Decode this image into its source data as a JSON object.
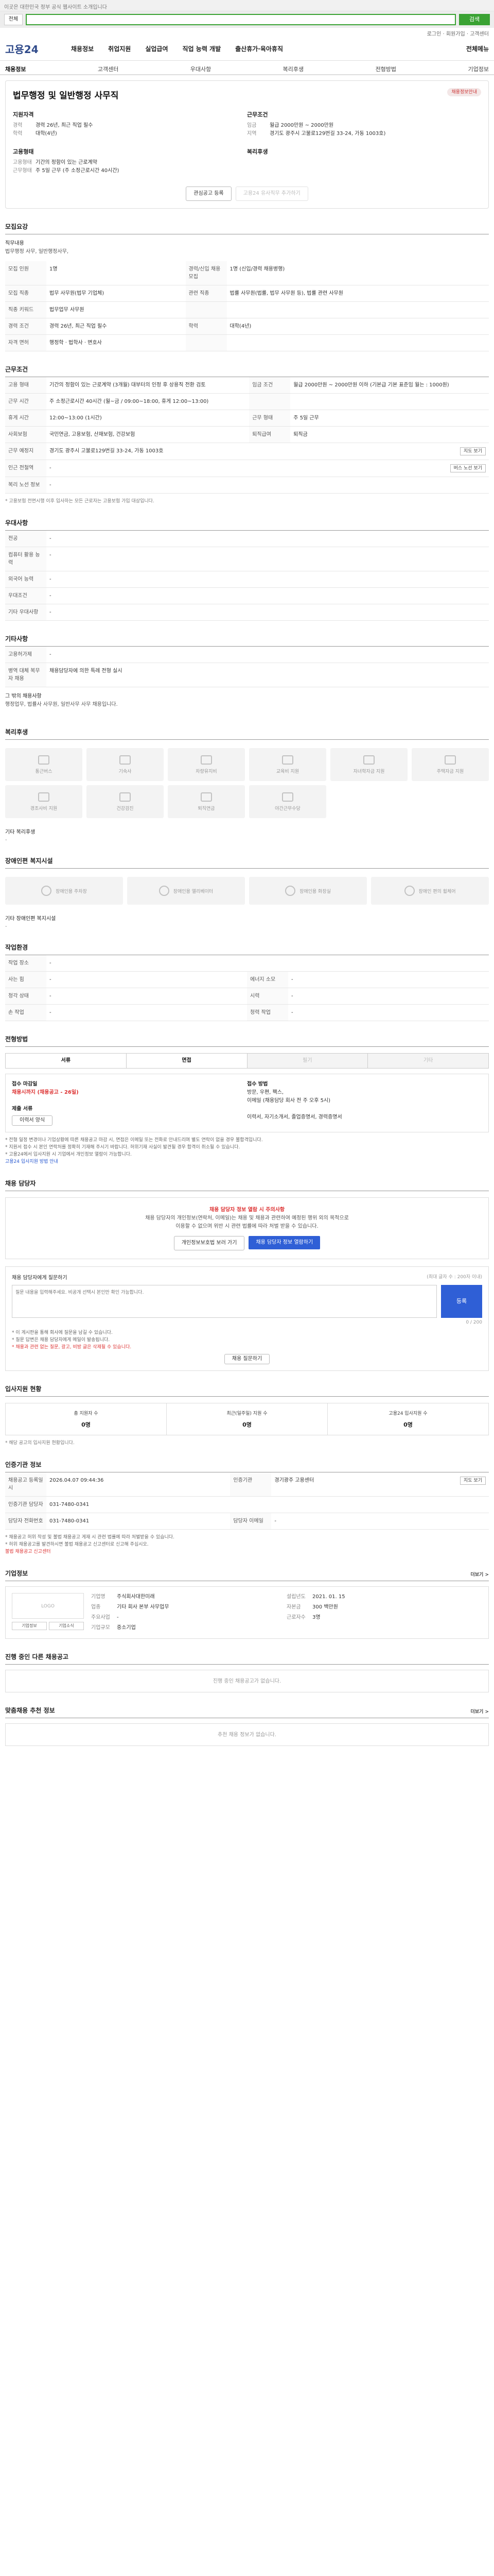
{
  "topbar": {
    "text": "이곳은 대한민국 정부 공식 웹사이트 소개입니다"
  },
  "search": {
    "scope": "전체",
    "button": "검색"
  },
  "util": {
    "links": "로그인 · 회원가입 · 고객센터"
  },
  "gnb": {
    "logo": "고용24",
    "menus": [
      "채용정보",
      "취업지원",
      "실업급여",
      "직업 능력 개발",
      "출산휴가·육아휴직"
    ],
    "last": "전체메뉴"
  },
  "subnav": [
    "채용정보",
    "고객센터",
    "우대사항",
    "복리후생",
    "전형방법",
    "기업정보"
  ],
  "job": {
    "title": "법무행정 및 일반행정 사무직",
    "top_badge": "채용정보안내",
    "left_head": "지원자격",
    "left_rows": [
      {
        "k": "경력",
        "v": "경력 26년, 최근 직업 필수"
      },
      {
        "k": "학력",
        "v": "대학(4년)"
      }
    ],
    "right_head": "근무조건",
    "right_rows": [
      {
        "k": "임금",
        "v": "월급 2000만원 ~ 2000만원"
      },
      {
        "k": "지역",
        "v": "경기도 광주시 고불로129번길 33-24, 가동 1003호)"
      }
    ],
    "left_head2": "고용형태",
    "left_rows2": [
      {
        "k": "고용형태",
        "v": "기간의 정함이 있는 근로계약"
      },
      {
        "k": "근무형태",
        "v": "주 5일 근무 (주 소정근로시간 40시간)"
      }
    ],
    "right_head2": "복리후생",
    "btn_scrap": "관심공고 등록",
    "btn_similar": "고용24 유사직무 추가하기"
  },
  "recruit": {
    "title": "모집요강",
    "label": "직무내용",
    "content": "법무행정 사무, 일반행정사무,",
    "rows": [
      {
        "k": "모집 인원",
        "v": "1명",
        "k2": "경력/신입 채용 모집",
        "v2": "1명 (신입/경력 채용병행)"
      },
      {
        "k": "모집 직종",
        "v": "법무 사무원(법무 기업체)",
        "k2": "관련 직종",
        "v2": "법률 사무원(법률, 법무 사무원 등), 법률 관련 사무원"
      },
      {
        "k": "직종 키워드",
        "v": "법무업무 사무원",
        "k2": "",
        "v2": ""
      },
      {
        "k": "경력 조건",
        "v": "경력 26년, 최근 직업 필수",
        "k2": "학력",
        "v2": "대학(4년)"
      },
      {
        "k": "자격 면허",
        "v": "행정학 · 법학사 · 변호사",
        "k2": "",
        "v2": ""
      }
    ]
  },
  "conditions": {
    "title": "근무조건",
    "rows": [
      {
        "k": "고용 형태",
        "v": "기간의 정함이 있는 근로계약 (3개월) 대부터의 인정 후 상용직 전환 검토",
        "k2": "임금 조건",
        "v2": "월급 2000만원 ~ 2000만원 이하 (기본급 기본 표준임 월는 : 1000원)"
      },
      {
        "k": "근무 시간",
        "v": "주 소정근로시간 40시간 (월~금 / 09:00~18:00, 휴게 12:00~13:00)",
        "k2": "",
        "v2": ""
      },
      {
        "k": "휴게 시간",
        "v": "12:00~13:00 (1시간)",
        "k2": "근무 형태",
        "v2": "주 5일 근무"
      },
      {
        "k": "사회보험",
        "v": "국민연금, 고용보험, 산재보험, 건강보험",
        "k2": "퇴직급여",
        "v2": "퇴직금"
      },
      {
        "k": "근무 예정지",
        "v": "경기도 광주시 고불로129번길 33-24, 가동 1003호",
        "k2": "",
        "v2": ""
      },
      {
        "k": "인근 전철역",
        "v": "-",
        "k2": "",
        "v2": ""
      },
      {
        "k": "복리 노선 정보",
        "v": "-",
        "k2": "",
        "v2": ""
      }
    ],
    "map_btn": "지도 보기",
    "near_btn": "버스 노선 보기",
    "note": "* 고용보험 전면시행 이후 입사하는 모든 근로자는 고용보험 가입 대상입니다."
  },
  "preferred": {
    "title": "우대사항",
    "rows": [
      {
        "k": "전공",
        "v": "-"
      },
      {
        "k": "컴퓨터 활용 능력",
        "v": "-"
      },
      {
        "k": "외국어 능력",
        "v": "-"
      },
      {
        "k": "우대조건",
        "v": "-"
      },
      {
        "k": "기타 우대사항",
        "v": "-"
      }
    ]
  },
  "other": {
    "title": "기타사항",
    "rows": [
      {
        "k": "고용허가제",
        "v": "-"
      },
      {
        "k": "병역 대체 복무자 채용",
        "v": "채용담당자에 의한 특례 전형 실시"
      }
    ],
    "extra_label": "그 밖의 채용사항",
    "extra_text": "행정업무, 법률사 사무원, 일반사무 사무 채용입니다."
  },
  "welfare": {
    "title": "복리후생",
    "items": [
      "통근버스",
      "기숙사",
      "차량유지비",
      "교육비 지원",
      "자녀학자금 지원",
      "주택자금 지원",
      "경조사비 지원",
      "건강검진",
      "퇴직연금",
      "야간근무수당"
    ],
    "sub_head": "기타 복리후생",
    "sub_body": "-"
  },
  "disability": {
    "title": "장애인편 복지시설",
    "items": [
      "장애인용 주차장",
      "장애인용 엘리베이터",
      "장애인용 화장실",
      "장애인 편의 휠체어"
    ],
    "sub_head": "기타 장애인편 복지시설",
    "sub_body": "-"
  },
  "workenv": {
    "title": "작업환경",
    "rows": [
      {
        "k": "작업 장소",
        "v": "-",
        "k2": "",
        "v2": ""
      },
      {
        "k": "사는 힘",
        "v": "-",
        "k2": "에너지 소모",
        "v2": "-"
      },
      {
        "k": "청각 상태",
        "v": "-",
        "k2": "시력",
        "v2": "-"
      },
      {
        "k": "손 작업",
        "v": "-",
        "k2": "청력 작업",
        "v2": "-"
      }
    ]
  },
  "process": {
    "title": "전형방법",
    "tabs": [
      "서류",
      "면접",
      "필기",
      "기타"
    ],
    "deadline_head": "접수 마감일",
    "deadline": "채용시까지 (채용공고 - 26일)",
    "method_head": "접수 방법",
    "method": "방문, 우편, 팩스,",
    "method2": "이메일 (채용담당 회사 전 주 오후 5시)",
    "docs_head": "제출 서류",
    "docs": "이력서, 자기소개서, 졸업증명서, 경력증명서",
    "docs_btn": "이력서 양식",
    "notes": [
      "* 전형 일정 변경이나 기업상황에 따른 채용공고 마감 시, 면접은 이메일 또는 전화로 안내드리며 별도 연락이 없을 경우 불합격입니다.",
      "* 지원서 접수 시 본인 연락처를 정확히 기재해 주시기 바랍니다. 허위기재 사실이 발견될 경우 합격이 취소될 수 있습니다.",
      "* 고용24에서 입사지원 시 기업에서 개인정보 열람이 가능합니다."
    ],
    "notes_link": "고용24 입사지원 방법 안내"
  },
  "contact": {
    "title": "채용 담당자",
    "warn": "채용 담당자 정보 열람 시 주의사항",
    "body1": "채용 담당자의 개인정보(연락처, 이메일)는 채용 및 채용과 관련하여 예정된 행위 외의 목적으로",
    "body2": "이용할 수 없으며 위반 시 관련 법률에 따라 처벌 받을 수 있습니다.",
    "btn1": "개인정보보호법 보러 가기",
    "btn2": "채용 담당자 정보 열람하기",
    "qa_title": "채용 담당자에게 질문하기",
    "qa_sub": "(최대 글자 수 : 200자 이내)",
    "qa_placeholder": "질문 내용을 입력해주세요. 비공개 선택시 본인만 확인 가능합니다.",
    "qa_btn": "등록",
    "qa_count": "0 / 200",
    "qa_notes": [
      "* 이 게시판을 통해 회사에 질문을 남길 수 있습니다.",
      "* 질문 답변은 채용 담당자에게 메일이 발송됩니다.",
      "* 채용과 관련 없는 질문, 광고, 비방 글은 삭제될 수 있습니다."
    ],
    "qa_btn2": "채용 질문하기"
  },
  "status": {
    "title": "입사지원 현황",
    "items": [
      {
        "k": "총 지원자 수",
        "v": "0명"
      },
      {
        "k": "최근(일주일) 지원 수",
        "v": "0명"
      },
      {
        "k": "고용24 입사지원 수",
        "v": "0명"
      }
    ],
    "note": "* 해당 공고의 입사지원 현황입니다."
  },
  "history": {
    "title": "인증기관 정보",
    "rows": [
      {
        "k": "채용공고 등록일시",
        "v": "2026.04.07 09:44:36",
        "k2": "인증기관",
        "v2": "경기광주 고용센터"
      },
      {
        "k": "인증기관 담당자",
        "v": "031-7480-0341",
        "k2": "",
        "v2": ""
      },
      {
        "k": "담당자 전화번호",
        "v": "031-7480-0341",
        "k2": "담당자 이메일",
        "v2": "-"
      }
    ],
    "map_btn": "지도 보기",
    "notes": [
      "* 채용공고 허위 작성 및 불법 채용공고 게재 시 관련 법률에 따라 처벌받을 수 있습니다.",
      "* 허위 채용공고를 발견하시면 불법 채용공고 신고센터로 신고해 주십시오."
    ],
    "report_link": "불법 채용공고 신고센터"
  },
  "company": {
    "title": "기업정보",
    "more": "더보기 >",
    "logo_ph": "LOGO",
    "logo_btn1": "기업정보",
    "logo_btn2": "기업소식",
    "rows": [
      {
        "k": "기업명",
        "v": "주식회사대한미래"
      },
      {
        "k": "설립년도",
        "v": "2021. 01. 15"
      },
      {
        "k": "업종",
        "v": "기타 회사 본부 사무업무"
      },
      {
        "k": "자본금",
        "v": "300 백만원"
      },
      {
        "k": "주요사업",
        "v": "-"
      },
      {
        "k": "근로자수",
        "v": "3명"
      },
      {
        "k": "기업규모",
        "v": "중소기업"
      },
      {
        "k": "",
        "v": ""
      }
    ]
  },
  "other_jobs": {
    "title": "진행 중인 다른 채용공고",
    "empty": "진행 중인 채용공고가 없습니다."
  },
  "recommend": {
    "title": "맞춤채용 추천 정보",
    "more": "더보기 >",
    "empty": "추천 채용 정보가 없습니다."
  }
}
